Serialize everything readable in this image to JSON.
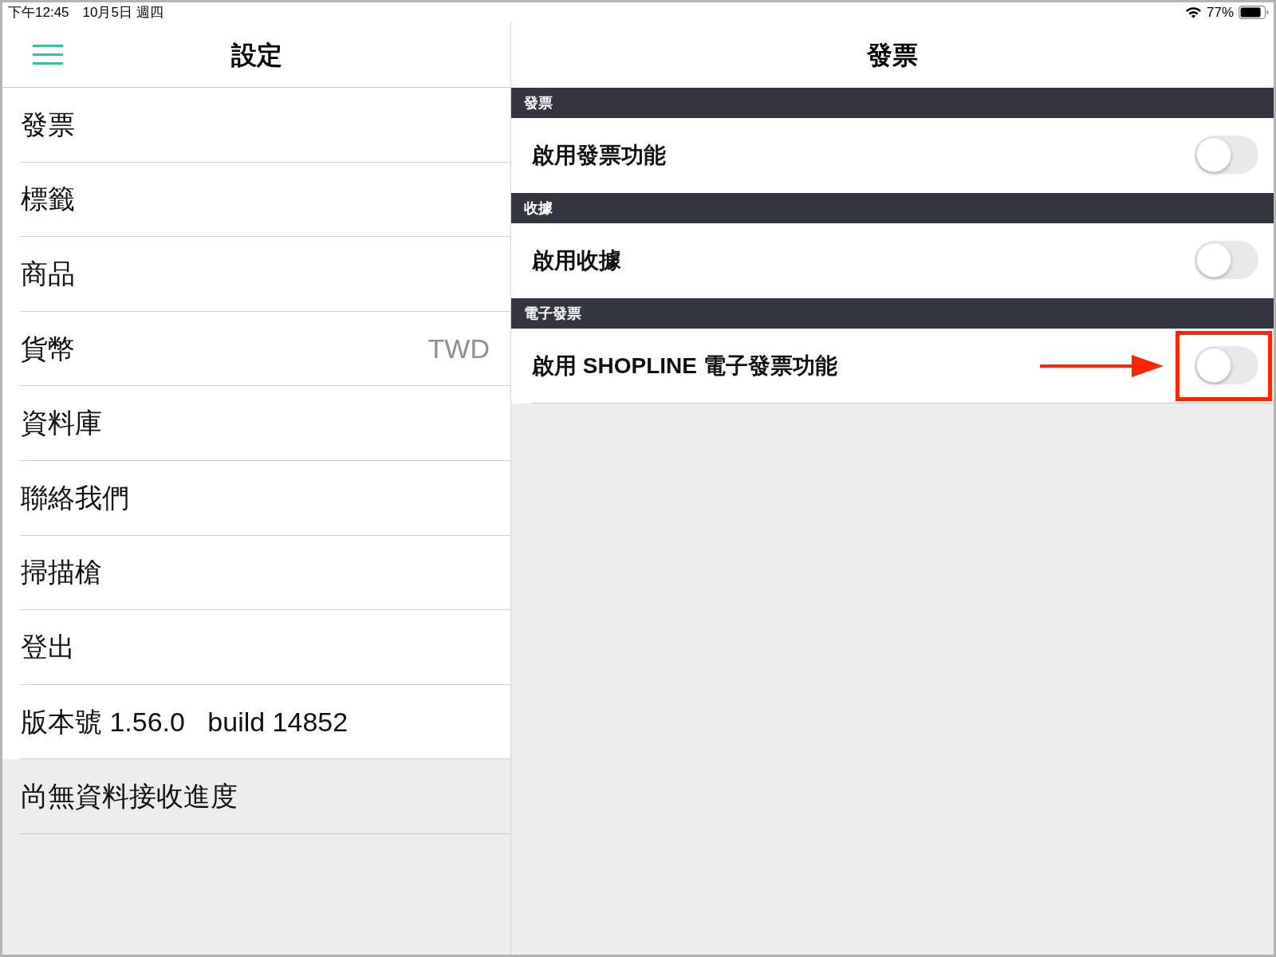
{
  "status_bar": {
    "time": "下午12:45",
    "date": "10月5日 週四",
    "battery": "77%"
  },
  "sidebar": {
    "title": "設定",
    "items": [
      {
        "kind": "row",
        "label": "發票"
      },
      {
        "kind": "row",
        "label": "標籤"
      },
      {
        "kind": "row",
        "label": "商品"
      },
      {
        "kind": "row",
        "label": "貨幣",
        "value": "TWD"
      },
      {
        "kind": "row",
        "label": "資料庫"
      },
      {
        "kind": "row",
        "label": "聯絡我們"
      },
      {
        "kind": "row",
        "label": "掃描槍"
      },
      {
        "kind": "row",
        "label": "登出"
      },
      {
        "kind": "row",
        "label": "版本號 1.56.0   build 14852"
      },
      {
        "kind": "status",
        "label": "尚無資料接收進度"
      }
    ]
  },
  "detail": {
    "title": "發票",
    "sections": [
      {
        "header": "發票",
        "rows": [
          {
            "label": "啟用發票功能",
            "on": false,
            "highlighted": false
          }
        ]
      },
      {
        "header": "收據",
        "rows": [
          {
            "label": "啟用收據",
            "on": false,
            "highlighted": false
          }
        ]
      },
      {
        "header": "電子發票",
        "rows": [
          {
            "label": "啟用 SHOPLINE 電子發票功能",
            "on": false,
            "highlighted": true
          }
        ]
      }
    ]
  }
}
